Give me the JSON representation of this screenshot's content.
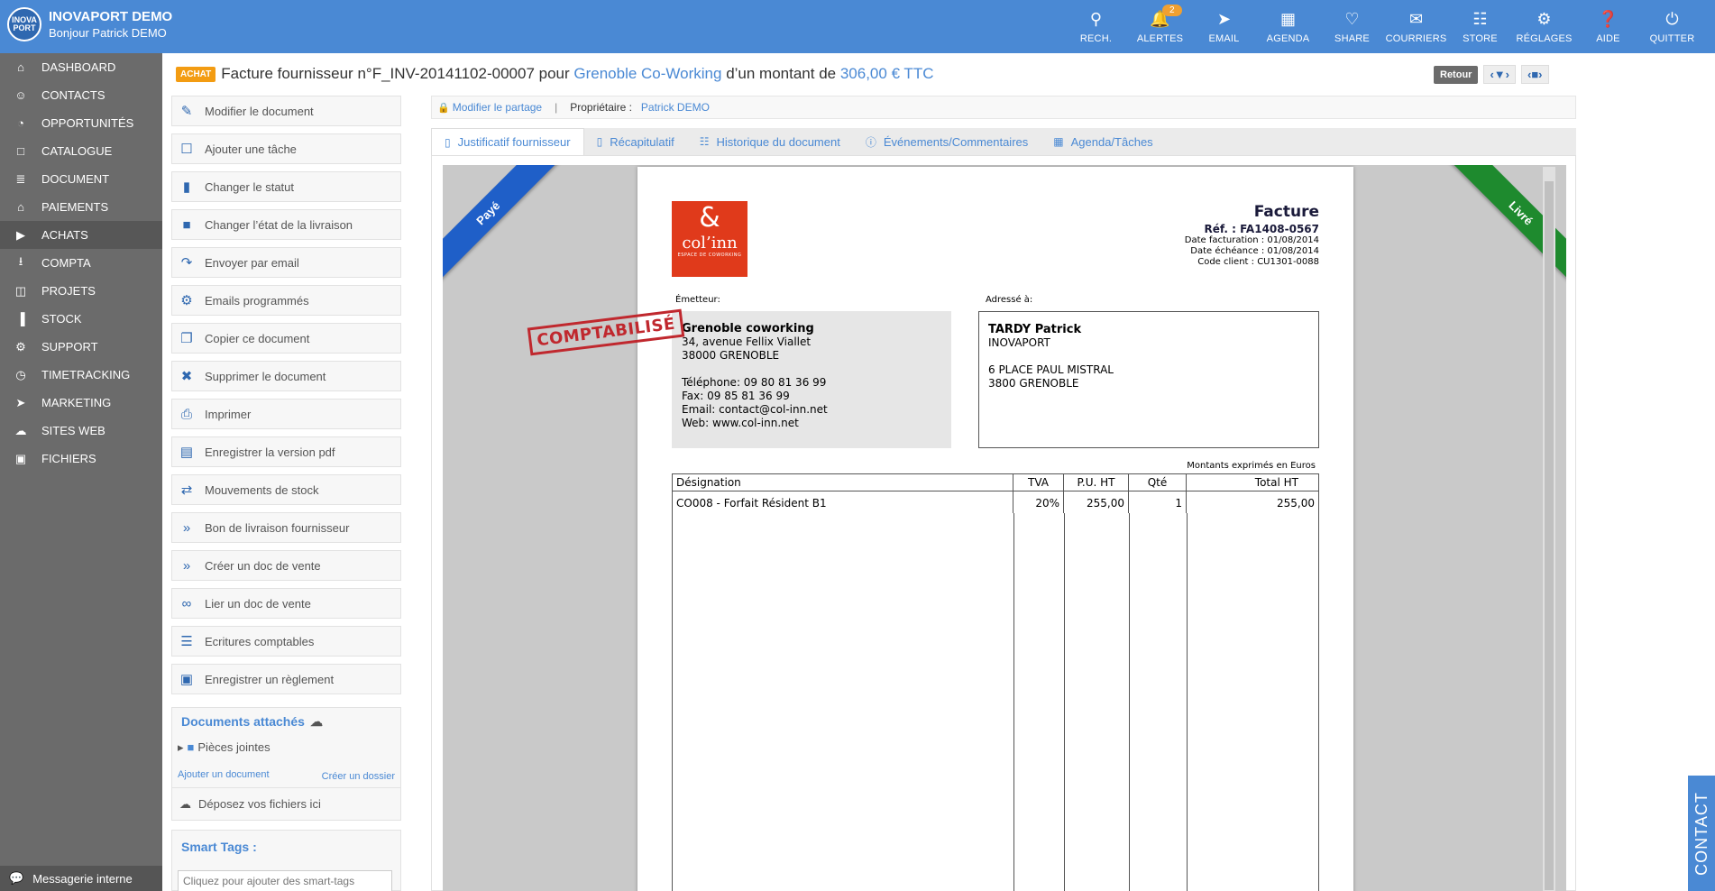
{
  "brand": {
    "title": "INOVAPORT DEMO",
    "subtitle": "Bonjour Patrick DEMO",
    "logo_text": "INOVA PORT"
  },
  "topnav": [
    {
      "icon": "search-icon",
      "glyph": "⚲",
      "label": "RECH."
    },
    {
      "icon": "bell-icon",
      "glyph": "🔔",
      "label": "ALERTES",
      "badge": "2"
    },
    {
      "icon": "send-icon",
      "glyph": "➤",
      "label": "EMAIL"
    },
    {
      "icon": "calendar-icon",
      "glyph": "▦",
      "label": "AGENDA"
    },
    {
      "icon": "heart-icon",
      "glyph": "♡",
      "label": "SHARE"
    },
    {
      "icon": "envelope-icon",
      "glyph": "✉",
      "label": "COURRIERS"
    },
    {
      "icon": "grid-icon",
      "glyph": "☷",
      "label": "STORE"
    },
    {
      "icon": "gear-icon",
      "glyph": "⚙",
      "label": "RÉGLAGES"
    },
    {
      "icon": "help-icon",
      "glyph": "❓",
      "label": "AIDE"
    },
    {
      "icon": "power-icon",
      "glyph": "⏻",
      "label": "QUITTER"
    }
  ],
  "sidebar": [
    {
      "icon": "home-icon",
      "glyph": "⌂",
      "label": "DASHBOARD"
    },
    {
      "icon": "users-icon",
      "glyph": "☺",
      "label": "CONTACTS"
    },
    {
      "icon": "chart-icon",
      "glyph": "◔",
      "label": "OPPORTUNITÉS"
    },
    {
      "icon": "folder-icon",
      "glyph": "□",
      "label": "CATALOGUE"
    },
    {
      "icon": "document-icon",
      "glyph": "≣",
      "label": "DOCUMENT"
    },
    {
      "icon": "bank-icon",
      "glyph": "⌂",
      "label": "PAIEMENTS"
    },
    {
      "icon": "truck-icon",
      "glyph": "▶",
      "label": "ACHATS"
    },
    {
      "icon": "download-icon",
      "glyph": "⭳",
      "label": "COMPTA"
    },
    {
      "icon": "columns-icon",
      "glyph": "◫",
      "label": "PROJETS"
    },
    {
      "icon": "barcode-icon",
      "glyph": "▐",
      "label": "STOCK"
    },
    {
      "icon": "gear-icon",
      "glyph": "⚙",
      "label": "SUPPORT"
    },
    {
      "icon": "clock-icon",
      "glyph": "◷",
      "label": "TIMETRACKING"
    },
    {
      "icon": "send-icon",
      "glyph": "➤",
      "label": "MARKETING"
    },
    {
      "icon": "cloud-icon",
      "glyph": "☁",
      "label": "SITES WEB"
    },
    {
      "icon": "briefcase-icon",
      "glyph": "▣",
      "label": "FICHIERS"
    }
  ],
  "sidebar_active_index": 6,
  "messagerie": {
    "label": "Messagerie interne",
    "glyph": "💬"
  },
  "title": {
    "badge": "ACHAT",
    "prefix": "Facture fournisseur n°F_INV-20141102-00007 pour ",
    "supplier": "Grenoble Co-Working",
    "middle": " d’un montant de ",
    "amount": "306,00 € TTC"
  },
  "tools": {
    "retour": "Retour",
    "nav1": "‹▼›",
    "nav2": "‹■›"
  },
  "actions": [
    {
      "icon": "edit-icon",
      "glyph": "✎",
      "label": "Modifier le document"
    },
    {
      "icon": "tasks-icon",
      "glyph": "☐",
      "label": "Ajouter une tâche"
    },
    {
      "icon": "bookmark-icon",
      "glyph": "▮",
      "label": "Changer le statut"
    },
    {
      "icon": "truck-icon",
      "glyph": "■",
      "label": "Changer l’état de la livraison"
    },
    {
      "icon": "share-icon",
      "glyph": "↷",
      "label": "Envoyer par email"
    },
    {
      "icon": "gear-icon",
      "glyph": "⚙",
      "label": "Emails programmés"
    },
    {
      "icon": "copy-icon",
      "glyph": "❐",
      "label": "Copier ce document"
    },
    {
      "icon": "delete-icon",
      "glyph": "✖",
      "label": "Supprimer le document"
    },
    {
      "icon": "print-icon",
      "glyph": "⎙",
      "label": "Imprimer"
    },
    {
      "icon": "pdf-icon",
      "glyph": "▤",
      "label": "Enregistrer la version pdf"
    },
    {
      "icon": "exchange-icon",
      "glyph": "⇄",
      "label": "Mouvements de stock"
    },
    {
      "icon": "double-chevron-icon",
      "glyph": "»",
      "label": "Bon de livraison fournisseur"
    },
    {
      "icon": "double-chevron-icon",
      "glyph": "»",
      "label": "Créer un doc de vente"
    },
    {
      "icon": "link-icon",
      "glyph": "∞",
      "label": "Lier un doc de vente"
    },
    {
      "icon": "list-icon",
      "glyph": "☰",
      "label": "Ecritures comptables"
    },
    {
      "icon": "money-icon",
      "glyph": "▣",
      "label": "Enregistrer un règlement"
    }
  ],
  "attached": {
    "title": "Documents attachés",
    "folder": "Pièces jointes",
    "add": "Ajouter un document",
    "create_folder": "Créer un dossier",
    "drop": "Déposez vos fichiers ici"
  },
  "smart_tags": {
    "title": "Smart Tags :",
    "placeholder": "Cliquez pour ajouter des smart-tags"
  },
  "share_bar": {
    "modify": "Modifier le partage",
    "owner_label": "Propriétaire :",
    "owner": "Patrick DEMO"
  },
  "tabs": [
    {
      "icon": "file-icon",
      "glyph": "▯",
      "label": "Justificatif fournisseur"
    },
    {
      "icon": "file-icon",
      "glyph": "▯",
      "label": "Récapitulatif"
    },
    {
      "icon": "sitemap-icon",
      "glyph": "☷",
      "label": "Historique du document"
    },
    {
      "icon": "info-icon",
      "glyph": "ⓘ",
      "label": "Événements/Commentaires"
    },
    {
      "icon": "calendar-icon",
      "glyph": "▦",
      "label": "Agenda/Tâches"
    }
  ],
  "ribbons": {
    "left": "Payé",
    "right": "Livré"
  },
  "stamp": "COMPTABILISÉ",
  "invoice": {
    "logo": {
      "amp": "&",
      "name": "col’inn",
      "sub": "ESPACE DE COWORKING"
    },
    "title": "Facture",
    "ref": "Réf. : FA1408-0567",
    "date_fact": "Date facturation : 01/08/2014",
    "date_ech": "Date échéance : 01/08/2014",
    "client_code": "Code client : CU1301-0088",
    "emetteur_label": "Émetteur:",
    "adresse_label": "Adressé à:",
    "emetteur": {
      "name": "Grenoble coworking",
      "line1": "34, avenue Fellix Viallet",
      "line2": "38000 GRENOBLE",
      "tel": "Téléphone: 09 80 81 36 99",
      "fax": "Fax: 09 85 81 36 99",
      "email": "Email: contact@col-inn.net",
      "web": "Web: www.col-inn.net"
    },
    "dest": {
      "name": "TARDY Patrick",
      "company": "INOVAPORT",
      "line1": "6 PLACE PAUL MISTRAL",
      "line2": "3800 GRENOBLE"
    },
    "montants": "Montants exprimés en Euros",
    "columns": [
      "Désignation",
      "TVA",
      "P.U. HT",
      "Qté",
      "Total HT"
    ],
    "rows": [
      {
        "designation": "CO008 - Forfait Résident B1",
        "tva": "20%",
        "pu": "255,00",
        "qte": "1",
        "total": "255,00"
      }
    ]
  },
  "contact_tab": "CONTACT"
}
